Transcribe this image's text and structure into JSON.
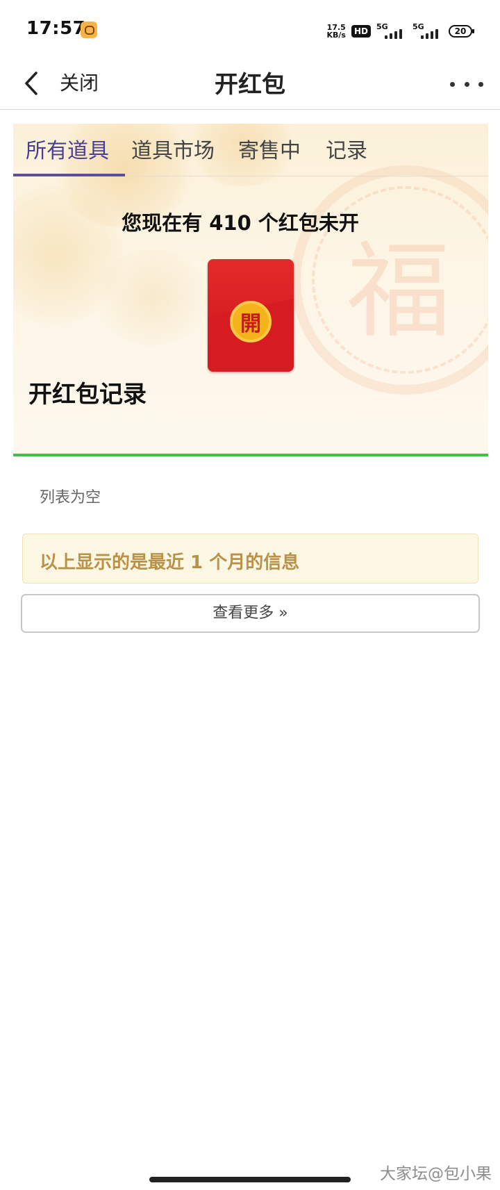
{
  "status_bar": {
    "time": "17:57",
    "net_speed_value": "17.5",
    "net_speed_unit": "KB/s",
    "hd_badge": "HD",
    "signal1_label": "5G",
    "signal2_label": "5G",
    "battery": "20",
    "app_icon": "chat-icon"
  },
  "nav": {
    "close_label": "关闭",
    "title": "开红包",
    "back_icon": "chevron-left-icon",
    "more_icon": "more-dots-icon"
  },
  "tabs": [
    {
      "label": "所有道具",
      "active": true
    },
    {
      "label": "道具市场",
      "active": false
    },
    {
      "label": "寄售中",
      "active": false
    },
    {
      "label": "记录",
      "active": false
    }
  ],
  "banner": {
    "count_text": "您现在有 410 个红包未开",
    "envelope_char": "開",
    "records_title": "开红包记录"
  },
  "records": {
    "empty_text": "列表为空",
    "info_text": "以上显示的是最近 1 个月的信息",
    "more_button": "查看更多 »"
  },
  "watermark": "大家坛@包小果",
  "colors": {
    "tab_active": "#4a3f8f",
    "envelope_red": "#e62a2a",
    "seal_gold": "#f4b21b",
    "green_bar": "#4cbb4c",
    "info_text": "#b99148",
    "info_bg": "#fcf7e3"
  }
}
